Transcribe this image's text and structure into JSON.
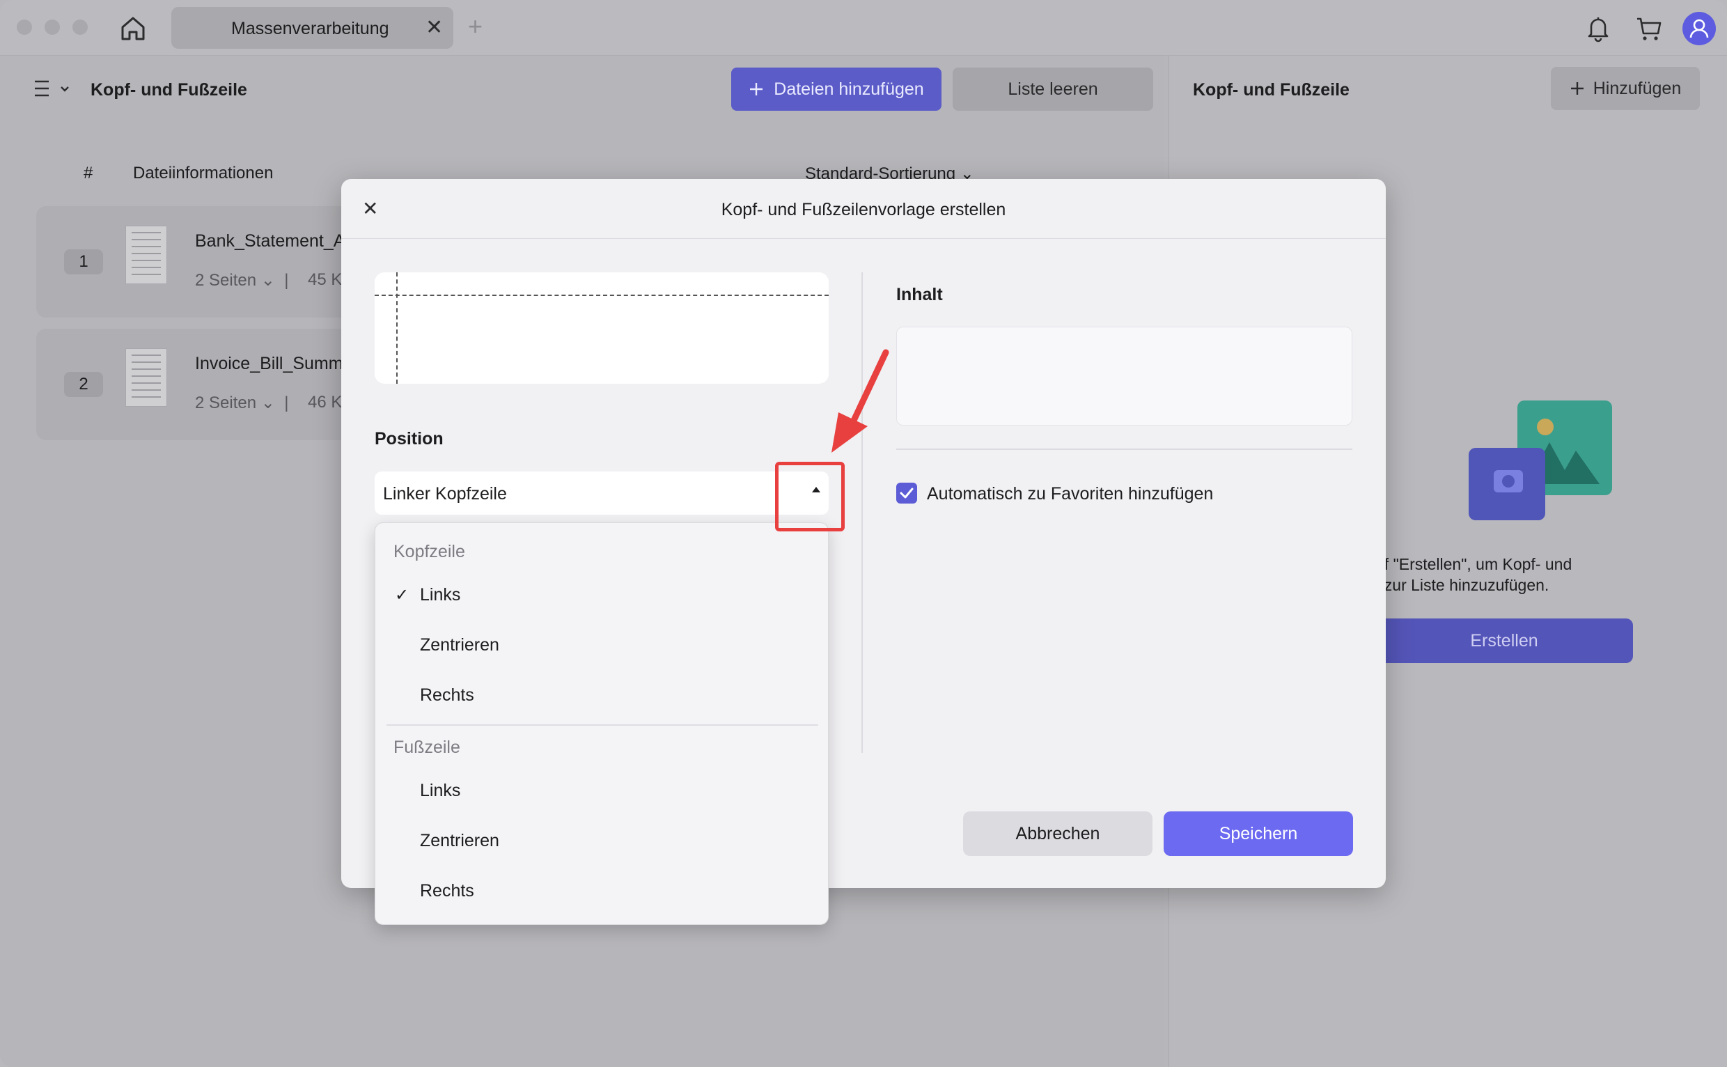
{
  "titlebar": {
    "tab_title": "Massenverarbeitung",
    "tab_close": "✕",
    "tab_add": "+"
  },
  "left_panel": {
    "title": "Kopf- und Fußzeile",
    "add_files_label": "Dateien hinzufügen",
    "clear_list_label": "Liste leeren",
    "col_number": "#",
    "col_info": "Dateiinformationen",
    "sort_label": "Standard-Sortierung",
    "files": [
      {
        "number": "1",
        "name": "Bank_Statement_A",
        "pages": "2 Seiten",
        "size": "45 K"
      },
      {
        "number": "2",
        "name": "Invoice_Bill_Summ",
        "pages": "2 Seiten",
        "size": "46 K"
      }
    ]
  },
  "right_panel": {
    "title": "Kopf- und Fußzeile",
    "add_label": "Hinzufügen",
    "empty_text_line1": "uf \"Erstellen\", um Kopf- und",
    "empty_text_line2": "ı zur Liste hinzuzufügen.",
    "create_label": "Erstellen"
  },
  "modal": {
    "title": "Kopf- und Fußzeilenvorlage erstellen",
    "close": "✕",
    "position_label": "Position",
    "position_value": "Linker Kopfzeile",
    "content_label": "Inhalt",
    "content_value": "",
    "favorite_label": "Automatisch zu Favoriten hinzufügen",
    "favorite_checked": true,
    "cancel_label": "Abbrechen",
    "save_label": "Speichern"
  },
  "dropdown": {
    "header_group": "Kopfzeile",
    "header_items": [
      "Links",
      "Zentrieren",
      "Rechts"
    ],
    "footer_group": "Fußzeile",
    "footer_items": [
      "Links",
      "Zentrieren",
      "Rechts"
    ],
    "selected_check": "✓"
  },
  "colors": {
    "accent": "#6b6af0",
    "annotation": "#e8403f"
  },
  "icons": [
    "home-icon",
    "bell-icon",
    "cart-icon",
    "user-icon",
    "menu-icon",
    "plus-icon",
    "chevron-down-icon",
    "close-icon",
    "check-icon"
  ]
}
